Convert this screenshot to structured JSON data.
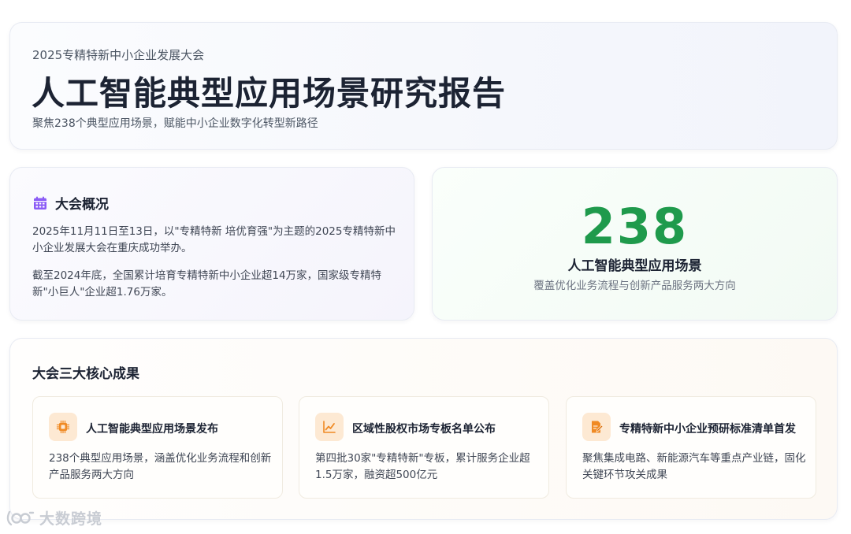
{
  "header": {
    "subtitle": "2025专精特新中小企业发展大会",
    "title": "人工智能典型应用场景研究报告",
    "tagline": "聚焦238个典型应用场景，赋能中小企业数字化转型新路径"
  },
  "overview": {
    "icon": "calendar-icon",
    "title": "大会概况",
    "paragraphs": [
      "2025年11月11日至13日，以\"专精特新 培优育强\"为主题的2025专精特新中小企业发展大会在重庆成功举办。",
      "截至2024年底，全国累计培育专精特新中小企业超14万家，国家级专精特新\"小巨人\"企业超1.76万家。"
    ]
  },
  "stat": {
    "number": "238",
    "label": "人工智能典型应用场景",
    "description": "覆盖优化业务流程与创新产品服务两大方向"
  },
  "achievements": {
    "title": "大会三大核心成果",
    "items": [
      {
        "icon": "chip-icon",
        "title": "人工智能典型应用场景发布",
        "description": "238个典型应用场景，涵盖优化业务流程和创新产品服务两大方向"
      },
      {
        "icon": "line-chart-icon",
        "title": "区域性股权市场专板名单公布",
        "description": "第四批30家\"专精特新\"专板，累计服务企业超1.5万家，融资超500亿元"
      },
      {
        "icon": "edit-document-icon",
        "title": "专精特新中小企业预研标准清单首发",
        "description": "聚焦集成电路、新能源汽车等重点产业链，固化关键环节攻关成果"
      }
    ]
  },
  "watermark": {
    "text": "大数跨境"
  },
  "colors": {
    "accent_green": "#1f9a4c",
    "accent_purple": "#8b5cf6",
    "accent_orange": "#f08a24",
    "icon_bg_orange": "#fde9d3",
    "title_dark": "#1c2333"
  }
}
